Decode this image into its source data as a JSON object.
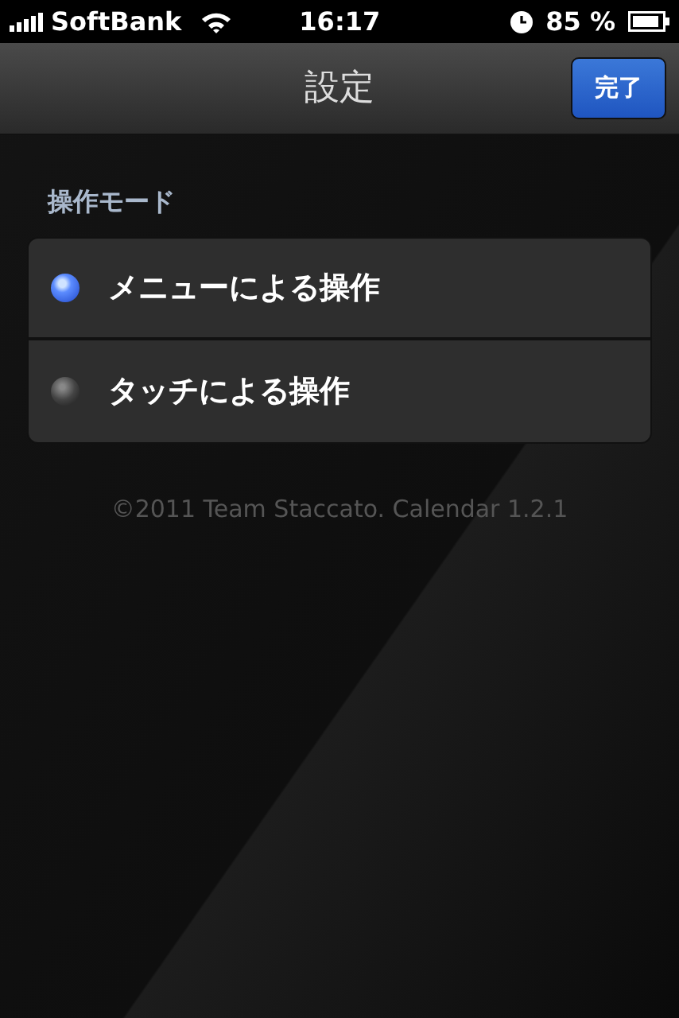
{
  "status_bar": {
    "carrier": "SoftBank",
    "time": "16:17",
    "battery": "85 %"
  },
  "nav_bar": {
    "title": "設定",
    "done_button": "完了"
  },
  "section": {
    "title": "操作モード",
    "options": [
      {
        "label": "メニューによる操作",
        "selected": true
      },
      {
        "label": "タッチによる操作",
        "selected": false
      }
    ]
  },
  "footer": "©2011 Team Staccato. Calendar 1.2.1"
}
